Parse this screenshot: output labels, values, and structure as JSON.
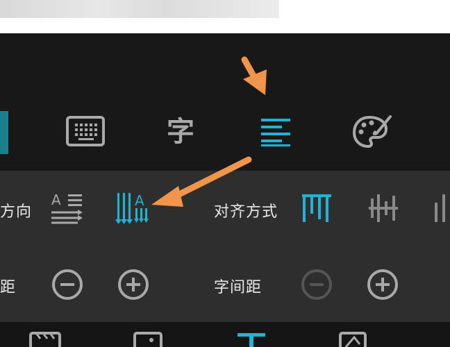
{
  "colors": {
    "accent": "#1fb3d6",
    "icon_gray": "#a9a9a9",
    "icon_disabled": "#555555",
    "arrow": "#f0954a",
    "toolbar_bg": "#181818",
    "panel_bg": "#2e2e2e"
  },
  "top_toolbar": {
    "items": [
      {
        "name": "keyboard-icon",
        "selected": false
      },
      {
        "name": "font-style-icon",
        "glyph": "字",
        "selected": false
      },
      {
        "name": "paragraph-align-icon",
        "selected": true
      },
      {
        "name": "palette-icon",
        "selected": false
      }
    ]
  },
  "panel": {
    "direction_label": "方向",
    "alignment_label": "对齐方式",
    "row_spacing_label": "距",
    "char_spacing_label": "字间距",
    "direction_options": [
      {
        "name": "horizontal-text-icon",
        "selected": false
      },
      {
        "name": "vertical-text-icon",
        "selected": true
      }
    ],
    "alignment_options": [
      {
        "name": "align-top-icon",
        "selected": true
      },
      {
        "name": "align-center-icon",
        "selected": false
      },
      {
        "name": "align-bottom-icon",
        "selected": false
      }
    ]
  },
  "bottom_bar": {
    "items": [
      "clip-icon",
      "sticker-icon",
      "text-icon",
      "image-icon"
    ],
    "selected": "text-icon"
  }
}
